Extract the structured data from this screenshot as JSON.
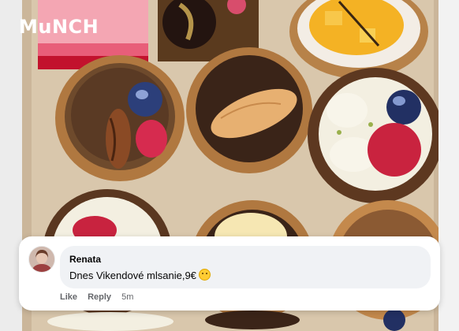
{
  "brand": {
    "logo_text": "MuNCH"
  },
  "comment": {
    "author": "Renata",
    "text": "Dnes Vikendové mlsanie,9€",
    "emoji_icon": "smiling-face-emoji",
    "actions": {
      "like": "Like",
      "reply": "Reply",
      "time": "5m"
    }
  }
}
